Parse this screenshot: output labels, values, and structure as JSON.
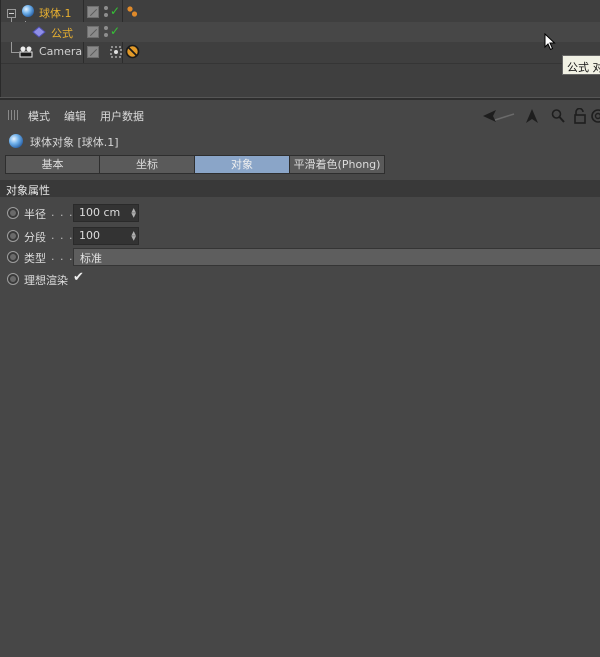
{
  "object_manager": {
    "objects": [
      {
        "name": "球体.1",
        "selected": true
      },
      {
        "name": "公式",
        "selected": true
      },
      {
        "name": "Camera",
        "selected": false
      }
    ],
    "tooltip": "公式 对"
  },
  "attribute_manager": {
    "menu": [
      "模式",
      "编辑",
      "用户数据"
    ],
    "object_title": "球体对象 [球体.1]",
    "tabs": [
      {
        "label": "基本",
        "active": false
      },
      {
        "label": "坐标",
        "active": false
      },
      {
        "label": "对象",
        "active": true
      },
      {
        "label": "平滑着色(Phong)",
        "active": false
      }
    ],
    "section_title": "对象属性",
    "properties": {
      "radius": {
        "label": "半径",
        "dots": ". . .",
        "value": "100 cm"
      },
      "segments": {
        "label": "分段",
        "dots": ". . .",
        "value": "100"
      },
      "type": {
        "label": "类型",
        "dots": ". . .",
        "value": "标准"
      },
      "perfect_render": {
        "label": "理想渲染",
        "checked": true,
        "mark": "✔"
      }
    }
  },
  "colors": {
    "selected_text": "#e8b030",
    "active_tab": "#8aa5c8",
    "check_green": "#35c335"
  }
}
